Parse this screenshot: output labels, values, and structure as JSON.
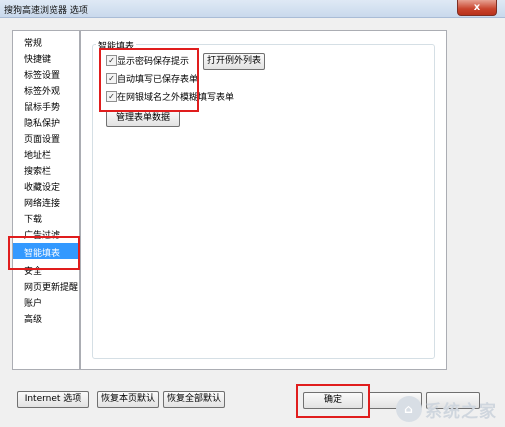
{
  "window": {
    "title": "搜狗高速浏览器 选项",
    "close_label": "x"
  },
  "sidebar": {
    "items": [
      {
        "label": "常规"
      },
      {
        "label": "快捷键"
      },
      {
        "label": "标签设置"
      },
      {
        "label": "标签外观"
      },
      {
        "label": "鼠标手势"
      },
      {
        "label": "隐私保护"
      },
      {
        "label": "页面设置"
      },
      {
        "label": "地址栏"
      },
      {
        "label": "搜索栏"
      },
      {
        "label": "收藏设定"
      },
      {
        "label": "网络连接"
      },
      {
        "label": "下载"
      },
      {
        "label": "广告过滤"
      },
      {
        "label": "智能填表",
        "selected": true
      },
      {
        "label": "安全"
      },
      {
        "label": "网页更新提醒"
      },
      {
        "label": "账户"
      },
      {
        "label": "高级"
      }
    ]
  },
  "content": {
    "group_title": "智能填表",
    "options": [
      {
        "label": "显示密码保存提示",
        "checked": true
      },
      {
        "label": "自动填写已保存表单",
        "checked": true
      },
      {
        "label": "在网银域名之外模糊填写表单",
        "checked": true
      }
    ],
    "open_exception_list_label": "打开例外列表",
    "manage_form_data_label": "管理表单数据"
  },
  "footer": {
    "internet_options_label": "Internet 选项",
    "restore_page_default_label": "恢复本页默认",
    "restore_all_default_label": "恢复全部默认",
    "ok_label": "确定"
  },
  "watermark": {
    "text": "系统之家"
  },
  "colors": {
    "selection": "#3399ff",
    "highlight_box": "#e01d1d"
  }
}
